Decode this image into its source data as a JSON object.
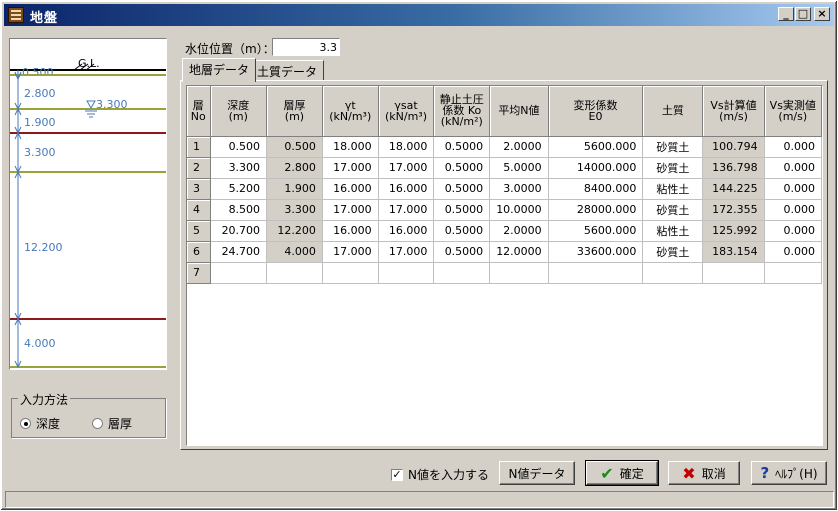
{
  "window": {
    "title": "地盤",
    "controls": {
      "minimize": "_",
      "maximize": "□",
      "close": "×"
    }
  },
  "water_level": {
    "label": "水位位置（m）：",
    "value": "3.3"
  },
  "tabs": [
    {
      "label": "地層データ",
      "active": true
    },
    {
      "label": "土質データ",
      "active": false
    }
  ],
  "profile": {
    "gl_label": "G.L.",
    "top_marker": "0.500",
    "water_label": "3.300",
    "layers": [
      {
        "thickness_label": "2.800",
        "line_color": "#9aa33a"
      },
      {
        "thickness_label": "1.900",
        "line_color": "#9aa33a"
      },
      {
        "thickness_label": "3.300",
        "line_color": "#9aa33a"
      },
      {
        "thickness_label": "12.200",
        "line_color": "#8b1a1a"
      },
      {
        "thickness_label": "4.000",
        "line_color": "#9aa33a"
      }
    ]
  },
  "input_method": {
    "legend": "入力方法",
    "options": [
      {
        "label": "深度",
        "selected": true
      },
      {
        "label": "層厚",
        "selected": false
      }
    ]
  },
  "table": {
    "columns": [
      "層\nNo",
      "深度\n(m)",
      "層厚\n(m)",
      "γt\n(kN/m³)",
      "γsat\n(kN/m³)",
      "静止土圧\n係数 Ko\n(kN/m²)",
      "平均N値",
      "変形係数\nE0",
      "土質",
      "Vs計算値\n(m/s)",
      "Vs実測値\n(m/s)"
    ],
    "rows": [
      [
        "1",
        "0.500",
        "0.500",
        "18.000",
        "18.000",
        "0.5000",
        "2.0000",
        "5600.000",
        "砂質土",
        "100.794",
        "0.000"
      ],
      [
        "2",
        "3.300",
        "2.800",
        "17.000",
        "17.000",
        "0.5000",
        "5.0000",
        "14000.000",
        "砂質土",
        "136.798",
        "0.000"
      ],
      [
        "3",
        "5.200",
        "1.900",
        "16.000",
        "16.000",
        "0.5000",
        "3.0000",
        "8400.000",
        "粘性土",
        "144.225",
        "0.000"
      ],
      [
        "4",
        "8.500",
        "3.300",
        "17.000",
        "17.000",
        "0.5000",
        "10.0000",
        "28000.000",
        "砂質土",
        "172.355",
        "0.000"
      ],
      [
        "5",
        "20.700",
        "12.200",
        "16.000",
        "16.000",
        "0.5000",
        "2.0000",
        "5600.000",
        "粘性土",
        "125.992",
        "0.000"
      ],
      [
        "6",
        "24.700",
        "4.000",
        "17.000",
        "17.000",
        "0.5000",
        "12.0000",
        "33600.000",
        "砂質土",
        "183.154",
        "0.000"
      ],
      [
        "7",
        "",
        "",
        "",
        "",
        "",
        "",
        "",
        "",
        "",
        ""
      ]
    ]
  },
  "footer": {
    "n_value_checkbox": {
      "label": "N値を入力する",
      "checked": true,
      "mark": "✓"
    },
    "n_data_button": "N値データ",
    "ok_button": "確定",
    "cancel_button": "取消",
    "help_button": "ﾍﾙﾌﾟ(H)"
  }
}
